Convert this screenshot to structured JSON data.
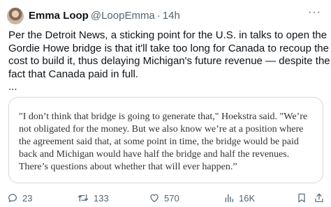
{
  "author": {
    "name": "Emma Loop",
    "handle": "@LoopEmma",
    "separator": "·",
    "time": "14h"
  },
  "more_label": "···",
  "body_lines": [
    "Per the Detroit News, a sticking point for the U.S. in talks to open the",
    "Gordie Howe bridge is that it'll take too long for Canada to recoup the",
    "cost to build it, thus delaying Michigan's future revenue — despite the",
    "fact that Canada paid in full.",
    "..."
  ],
  "quote_lines": [
    "\"I don’t think that bridge is going to generate that,\" Hoekstra said. \"We’re",
    "not obligated for the money. But we also know we’re at a position where",
    "the agreement said that, at some point in time, the bridge would be paid",
    "back and Michigan would have half the bridge and half the revenues.",
    "There’s questions about whether that will ever happen.”"
  ],
  "actions": {
    "replies": "23",
    "reposts": "133",
    "likes": "570",
    "views": "16K"
  },
  "icons": {
    "reply": "reply-icon",
    "repost": "repost-icon",
    "like": "heart-icon",
    "views": "views-icon",
    "bookmark": "bookmark-icon",
    "share": "share-icon",
    "more": "more-icon"
  },
  "colors": {
    "text": "#0f1419",
    "secondary": "#536471",
    "border": "#cfd9de"
  }
}
